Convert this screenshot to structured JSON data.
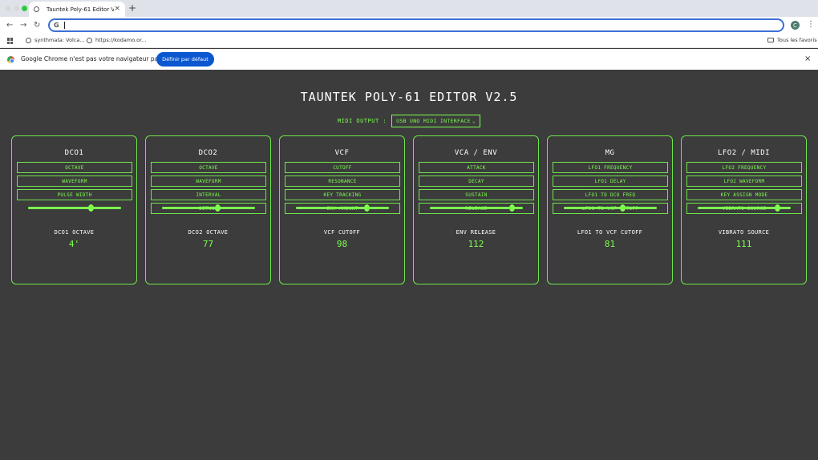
{
  "browser": {
    "tab_title": "Tauntek Poly-61 Editor V2.5",
    "tab_close": "×",
    "new_tab": "+",
    "back": "←",
    "forward": "→",
    "reload": "↻",
    "omnibox_icon": "G",
    "profile_initial": "C",
    "menu": "⋮",
    "bookmarks": [
      {
        "label": "synthmata: Volca..."
      },
      {
        "label": "https://kodamo.or..."
      }
    ],
    "all_bookmarks": "Tous les favoris",
    "infobar_message": "Google Chrome n'est pas votre navigateur par défaut",
    "infobar_button": "Définir par défaut",
    "infobar_close": "×"
  },
  "app": {
    "title": "TAUNTEK POLY-61 EDITOR V2.5",
    "midi_output_label": "MIDI OUTPUT :",
    "midi_output_value": "USB UNO MIDI INTERFACE",
    "midi_output_caret": "⌄",
    "panels": [
      {
        "title": "DCO1",
        "buttons": [
          "OCTAVE",
          "WAVEFORM",
          "PULSE WIDTH"
        ],
        "slider": 0.68,
        "param_label": "DCO1 OCTAVE",
        "param_value": "4'"
      },
      {
        "title": "DCO2",
        "buttons": [
          "OCTAVE",
          "WAVEFORM",
          "INTERVAL",
          "DETUNE"
        ],
        "slider": 0.6,
        "param_label": "DCO2 OCTAVE",
        "param_value": "77"
      },
      {
        "title": "VCF",
        "buttons": [
          "CUTOFF",
          "RESONANCE",
          "KEY TRACKING",
          "ENV AMOUNT"
        ],
        "slider": 0.76,
        "param_label": "VCF CUTOFF",
        "param_value": "98"
      },
      {
        "title": "VCA / ENV",
        "buttons": [
          "ATTACK",
          "DECAY",
          "SUSTAIN",
          "RELEASE"
        ],
        "slider": 0.88,
        "param_label": "ENV RELEASE",
        "param_value": "112"
      },
      {
        "title": "MG",
        "buttons": [
          "LFO1 FREQUENCY",
          "LFO1 DELAY",
          "LFO1 TO DCO FREQ",
          "LFO1 TO VCF CUTOFF"
        ],
        "slider": 0.63,
        "param_label": "LFO1 TO VCF CUTOFF",
        "param_value": "81"
      },
      {
        "title": "LFO2 / MIDI",
        "buttons": [
          "LFO2 FREQUENCY",
          "LFO2 WAVEFORM",
          "KEY ASSIGN MODE",
          "VIBRATO SOURCE"
        ],
        "slider": 0.86,
        "param_label": "VIBRATO SOURCE",
        "param_value": "111"
      }
    ]
  },
  "colors": {
    "accent": "#7cff4f",
    "background": "#3c3c3c",
    "chrome_blue": "#0b57d0"
  }
}
